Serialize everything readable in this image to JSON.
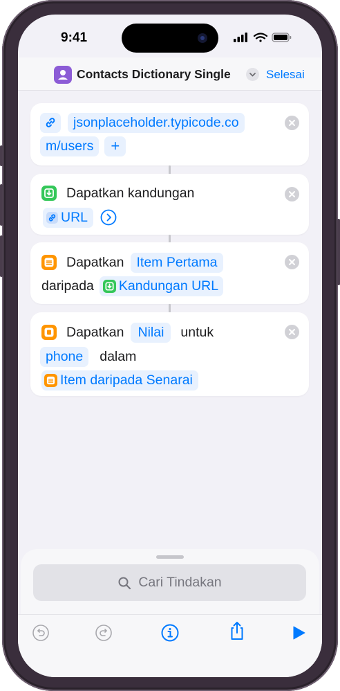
{
  "status_bar": {
    "time": "9:41"
  },
  "nav": {
    "title": "Contacts Dictionary Single",
    "done_label": "Selesai"
  },
  "actions": [
    {
      "url_part1": "jsonplaceholder.typicode.co",
      "url_part2": "m/users",
      "add_label": "+"
    },
    {
      "verb": "Dapatkan kandungan",
      "param": "URL"
    },
    {
      "verb": "Dapatkan",
      "param": "Item Pertama",
      "preposition": "daripada",
      "source": "Kandungan URL"
    },
    {
      "verb": "Dapatkan",
      "param": "Nilai",
      "connector": "untuk",
      "key": "phone",
      "preposition": "dalam",
      "source": "Item daripada Senarai"
    }
  ],
  "search": {
    "placeholder": "Cari Tindakan"
  },
  "toolbar": {
    "buttons": [
      "undo-icon",
      "redo-icon",
      "info-icon",
      "share-icon",
      "play-icon"
    ]
  },
  "colors": {
    "accent": "#007aff",
    "app_icon": "#8c5cd6",
    "web_icon": "#34c759",
    "list_icon": "#ff9500",
    "dictionary_icon": "#ff9500"
  }
}
